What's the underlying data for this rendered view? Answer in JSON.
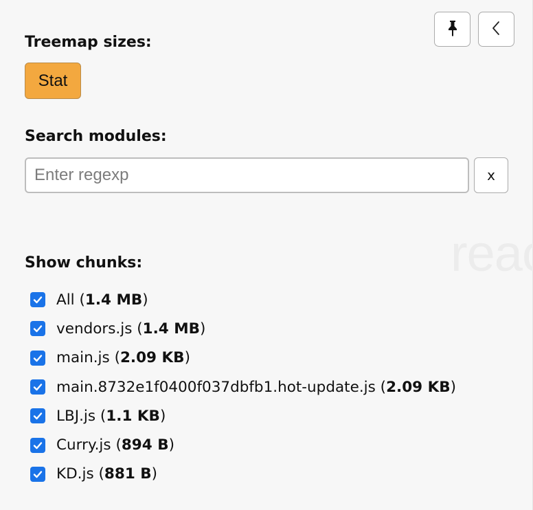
{
  "sidebar": {
    "pin_icon": "pin-icon",
    "collapse_icon": "chevron-left-icon",
    "background_word": "reac",
    "treemap": {
      "title": "Treemap sizes:",
      "options": [
        "Stat"
      ],
      "active_option": "Stat",
      "active_color": "#f3a83f"
    },
    "search": {
      "title": "Search modules:",
      "placeholder": "Enter regexp",
      "value": "",
      "clear_label": "x"
    },
    "chunks": {
      "title": "Show chunks:",
      "checkbox_color": "#1a73e8",
      "items": [
        {
          "name": "All",
          "size": "1.4 MB",
          "checked": true
        },
        {
          "name": "vendors.js",
          "size": "1.4 MB",
          "checked": true
        },
        {
          "name": "main.js",
          "size": "2.09 KB",
          "checked": true
        },
        {
          "name": "main.8732e1f0400f037dbfb1.hot-update.js",
          "size": "2.09 KB",
          "checked": true
        },
        {
          "name": "LBJ.js",
          "size": "1.1 KB",
          "checked": true
        },
        {
          "name": "Curry.js",
          "size": "894 B",
          "checked": true
        },
        {
          "name": "KD.js",
          "size": "881 B",
          "checked": true
        }
      ]
    }
  }
}
